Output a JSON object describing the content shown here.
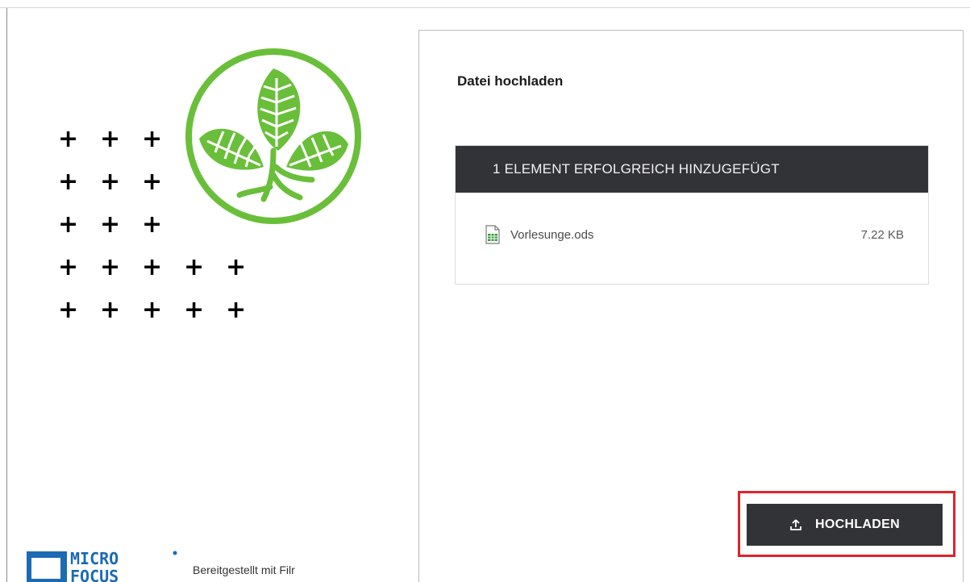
{
  "panel": {
    "title": "Datei hochladen",
    "status_header": "1 ELEMENT ERFOLGREICH HINZUGEFÜGT",
    "file": {
      "name": "Vorlesunge.ods",
      "size": "7.22 KB",
      "icon": "spreadsheet-file-icon"
    },
    "upload_button_label": "HOCHLADEN",
    "upload_button_icon": "upload-icon"
  },
  "branding": {
    "company_logo_text_line1": "MICRO",
    "company_logo_text_line2": "FOCUS",
    "powered_by": "Bereitgestellt mit Filr",
    "logo_color": "#1b6ab3",
    "leaf_color": "#6abf3a"
  },
  "decor": {
    "plus_glyph": "+"
  },
  "colors": {
    "header_bg": "#323336",
    "highlight_border": "#e0222a"
  }
}
